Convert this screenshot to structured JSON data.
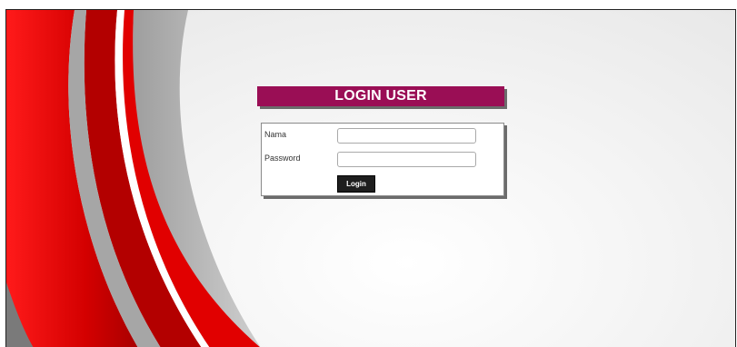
{
  "login": {
    "title": "LOGIN USER",
    "name_label": "Nama",
    "name_value": "",
    "password_label": "Password",
    "password_value": "",
    "submit_label": "Login"
  },
  "colors": {
    "header_bg": "#9a0e55",
    "button_bg": "#1e1e1e",
    "swoosh_red": "#d40000",
    "swoosh_gray": "#b8b8b8"
  },
  "background": {
    "decoration": "red-gray-swoosh"
  }
}
